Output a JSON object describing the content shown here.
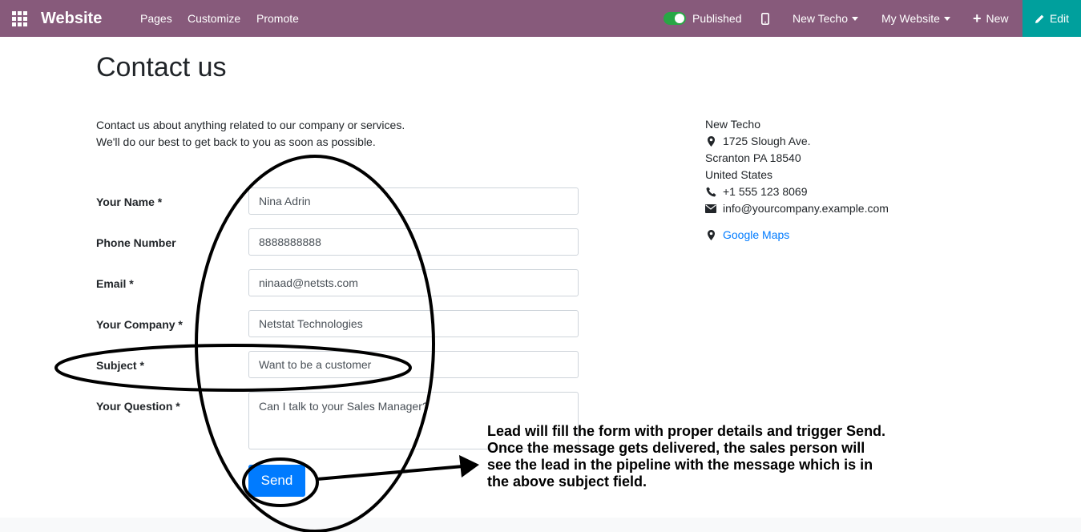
{
  "topbar": {
    "brand": "Website",
    "menu": [
      "Pages",
      "Customize",
      "Promote"
    ],
    "published_label": "Published",
    "company_switch": "New Techo",
    "website_switch": "My Website",
    "new_label": "New",
    "edit_label": "Edit",
    "colors": {
      "bar": "#875a7b",
      "edit": "#00a09d",
      "toggle": "#28a745"
    }
  },
  "page": {
    "title": "Contact us",
    "intro_line1": "Contact us about anything related to our company or services.",
    "intro_line2": "We'll do our best to get back to you as soon as possible."
  },
  "form": {
    "name_label": "Your Name *",
    "name_value": "Nina Adrin",
    "phone_label": "Phone Number",
    "phone_value": "8888888888",
    "email_label": "Email *",
    "email_value": "ninaad@netsts.com",
    "company_label": "Your Company *",
    "company_value": "Netstat Technologies",
    "subject_label": "Subject *",
    "subject_value": "Want to be a customer",
    "question_label": "Your Question *",
    "question_value": "Can I talk to your Sales Manager?",
    "send_label": "Send"
  },
  "contact": {
    "company": "New Techo",
    "street": "1725 Slough Ave.",
    "city": "Scranton PA 18540",
    "country": "United States",
    "phone": "+1 555 123 8069",
    "email": "info@yourcompany.example.com",
    "maps_label": "Google Maps"
  },
  "annotation": {
    "text": "Lead will fill the form with proper details and trigger Send. Once the message gets delivered, the sales person will see the lead in the pipeline with the message which is in the above subject field."
  }
}
